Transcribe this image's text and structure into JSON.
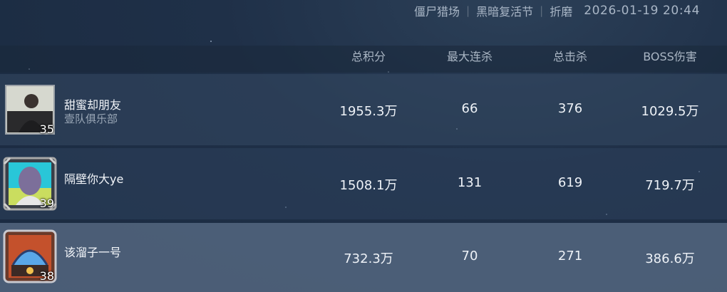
{
  "meta": {
    "mode": "僵尸猎场",
    "map": "黑暗复活节",
    "difficulty": "折磨",
    "timestamp": "2026-01-19 20:44"
  },
  "columns": [
    "总积分",
    "最大连杀",
    "总击杀",
    "BOSS伤害"
  ],
  "players": [
    {
      "name": "甜蜜却朋友",
      "club": "壹队俱乐部",
      "level": "35",
      "score": "1955.3万",
      "max_streak": "66",
      "kills": "376",
      "boss_damage": "1029.5万"
    },
    {
      "name": "隔壁你大ye",
      "club": "",
      "level": "39",
      "score": "1508.1万",
      "max_streak": "131",
      "kills": "619",
      "boss_damage": "719.7万"
    },
    {
      "name": "该溜子一号",
      "club": "",
      "level": "38",
      "score": "732.3万",
      "max_streak": "70",
      "kills": "271",
      "boss_damage": "386.6万"
    }
  ],
  "colors": {
    "row_highlight": "#5a6c85",
    "text": "#eef2f7",
    "subtext": "#9aa7b6"
  }
}
